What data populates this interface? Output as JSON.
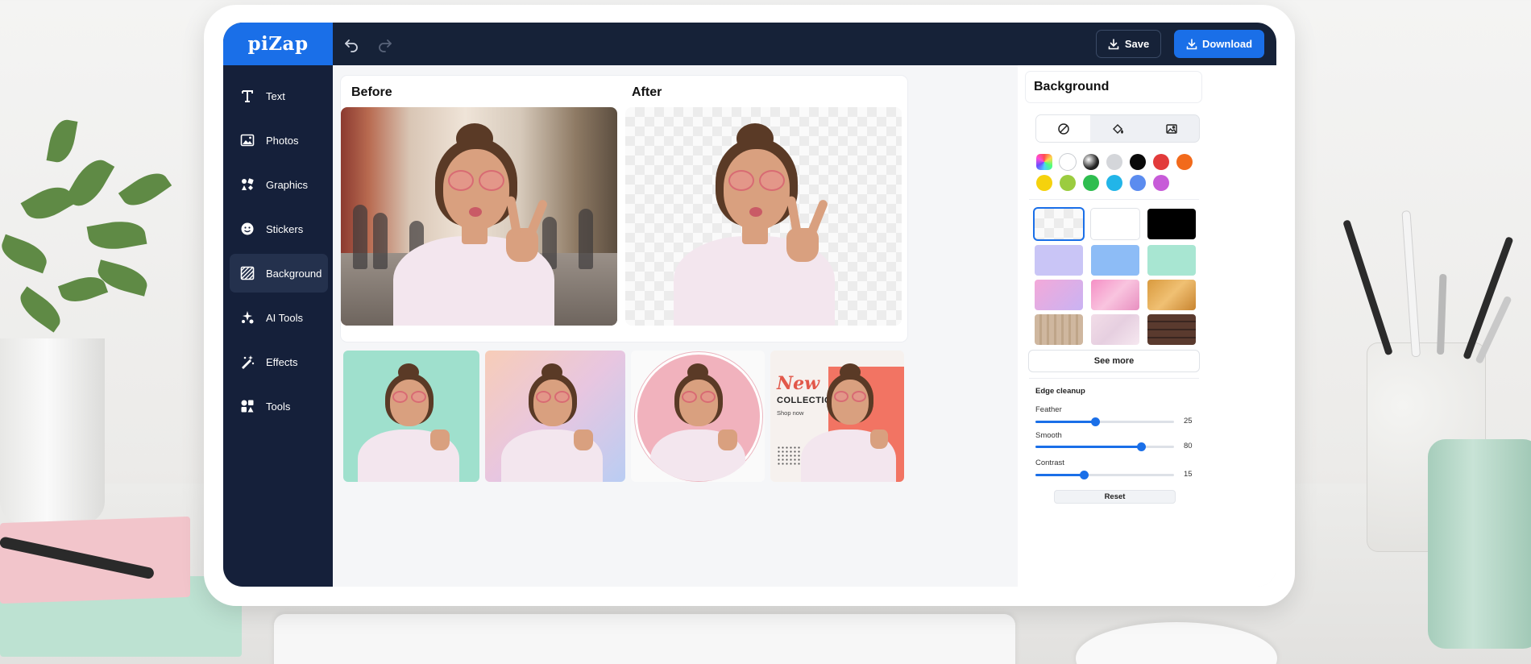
{
  "app": {
    "logo": "piZap",
    "toolbar": {
      "save_label": "Save",
      "download_label": "Download"
    }
  },
  "sidebar": {
    "items": [
      {
        "label": "Text",
        "icon": "text-icon"
      },
      {
        "label": "Photos",
        "icon": "photos-icon"
      },
      {
        "label": "Graphics",
        "icon": "graphics-icon"
      },
      {
        "label": "Stickers",
        "icon": "stickers-icon"
      },
      {
        "label": "Background",
        "icon": "background-icon",
        "active": true
      },
      {
        "label": "AI Tools",
        "icon": "ai-tools-icon"
      },
      {
        "label": "Effects",
        "icon": "effects-icon"
      },
      {
        "label": "Tools",
        "icon": "tools-icon"
      }
    ]
  },
  "preview": {
    "before_label": "Before",
    "after_label": "After"
  },
  "thumbnails": {
    "promo": {
      "new": "New",
      "collection": "COLLECTION",
      "shop": "Shop now"
    }
  },
  "panel": {
    "title": "Background",
    "tabs": [
      "none-icon",
      "fill-icon",
      "image-icon"
    ],
    "colors": [
      "#ff4d4d",
      "#ffffff",
      "#222222",
      "#d4d6da",
      "#0a0a0a",
      "#e23b3b",
      "#f26a1b",
      "#f5d20d",
      "#9bcc3f",
      "#2ebd4f",
      "#22b5e8",
      "#5b8cef",
      "#c75bd8"
    ],
    "see_more_label": "See more",
    "edge_cleanup": {
      "title": "Edge cleanup",
      "sliders": [
        {
          "label": "Feather",
          "value": "25",
          "fraction": 0.43
        },
        {
          "label": "Smooth",
          "value": "80",
          "fraction": 0.76
        },
        {
          "label": "Contrast",
          "value": "15",
          "fraction": 0.35
        }
      ],
      "reset_label": "Reset"
    }
  },
  "colors": {
    "accent": "#1a6fe8",
    "sidebar": "#15203a",
    "topbar": "#162238"
  }
}
